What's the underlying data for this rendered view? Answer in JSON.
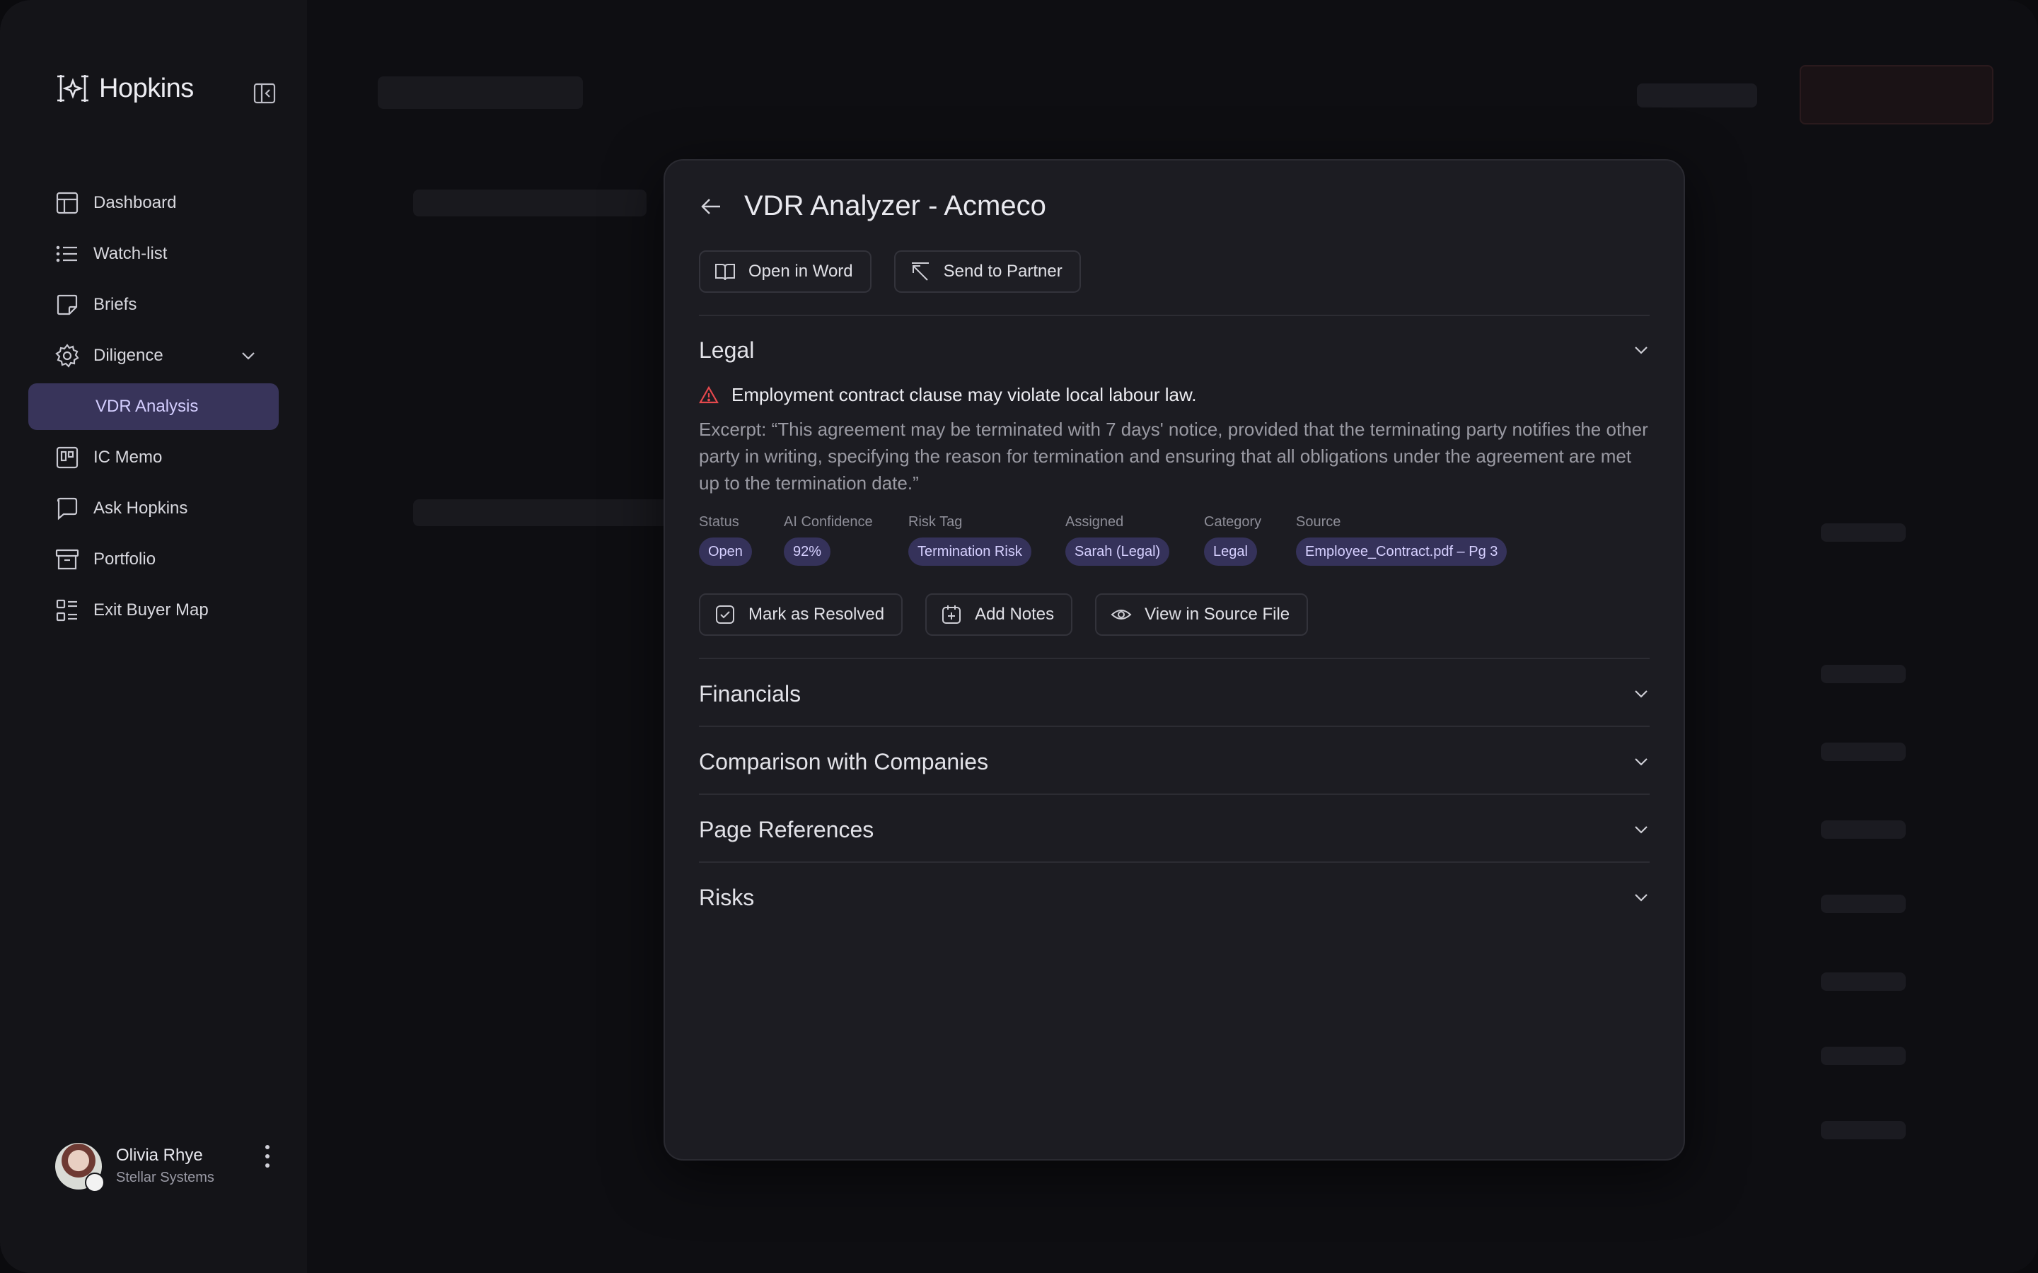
{
  "app": {
    "name": "Hopkins"
  },
  "sidebar": {
    "items": [
      {
        "label": "Dashboard",
        "icon": "layout-icon"
      },
      {
        "label": "Watch-list",
        "icon": "list-icon"
      },
      {
        "label": "Briefs",
        "icon": "note-icon"
      },
      {
        "label": "Diligence",
        "icon": "gear-icon"
      },
      {
        "label": "VDR Analysis"
      },
      {
        "label": "IC Memo",
        "icon": "memo-icon"
      },
      {
        "label": "Ask Hopkins",
        "icon": "chat-icon"
      },
      {
        "label": "Portfolio",
        "icon": "archive-icon"
      },
      {
        "label": "Exit Buyer Map",
        "icon": "map-list-icon"
      }
    ],
    "active": "VDR Analysis"
  },
  "user": {
    "name": "Olivia Rhye",
    "org": "Stellar Systems"
  },
  "modal": {
    "title": "VDR Analyzer - Acmeco",
    "toolbar": {
      "open_word": "Open in Word",
      "send_partner": "Send to Partner"
    },
    "sections": {
      "legal": "Legal",
      "financials": "Financials",
      "comparison": "Comparison with Companies",
      "page_refs": "Page References",
      "risks": "Risks"
    },
    "finding": {
      "headline": "Employment contract clause may violate local labour law.",
      "excerpt": "Excerpt: “This agreement may be terminated with 7 days' notice, provided that the terminating party notifies the other party in writing, specifying the reason for termination and ensuring that all obligations under the agreement are met up to the termination date.”",
      "meta": {
        "status_label": "Status",
        "status": "Open",
        "confidence_label": "AI Confidence",
        "confidence": "92%",
        "risk_label": "Risk Tag",
        "risk": "Termination Risk",
        "assigned_label": "Assigned",
        "assigned": "Sarah (Legal)",
        "category_label": "Category",
        "category": "Legal",
        "source_label": "Source",
        "source": "Employee_Contract.pdf – Pg 3"
      },
      "actions": {
        "resolve": "Mark as Resolved",
        "notes": "Add Notes",
        "view_source": "View in Source File"
      }
    }
  },
  "colors": {
    "accent": "#38345a",
    "pill": "#35325a",
    "warning": "#e5484d"
  }
}
